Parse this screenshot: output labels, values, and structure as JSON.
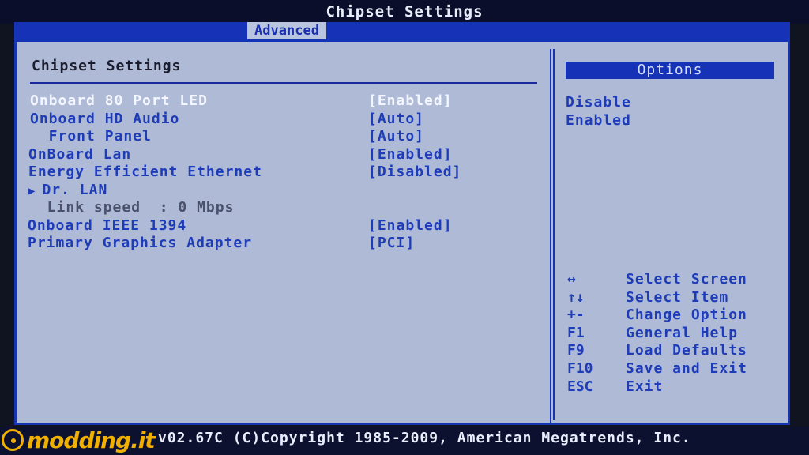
{
  "title": "Chipset Settings",
  "tab": "Advanced",
  "section_heading": "Chipset Settings",
  "settings": [
    {
      "label": "Onboard 80 Port LED",
      "value": "[Enabled]",
      "selected": true
    },
    {
      "label": "Onboard HD Audio",
      "value": "[Auto]"
    },
    {
      "label": "  Front Panel",
      "value": "[Auto]"
    },
    {
      "label": "OnBoard Lan",
      "value": "[Enabled]"
    },
    {
      "label": "Energy Efficient Ethernet",
      "value": "[Disabled]"
    },
    {
      "label": "Dr. LAN",
      "value": "",
      "submenu": true
    },
    {
      "label": "  Link speed  : 0 Mbps",
      "value": "",
      "info": true
    },
    {
      "label": "Onboard IEEE 1394",
      "value": "[Enabled]"
    },
    {
      "label": "Primary Graphics Adapter",
      "value": "[PCI]"
    }
  ],
  "options_header": "Options",
  "options": [
    "Disable",
    "Enabled"
  ],
  "help": [
    {
      "key": "↔",
      "desc": "Select Screen"
    },
    {
      "key": "↑↓",
      "desc": "Select Item"
    },
    {
      "key": "+-",
      "desc": "Change Option"
    },
    {
      "key": "F1",
      "desc": "General Help"
    },
    {
      "key": "F9",
      "desc": "Load Defaults"
    },
    {
      "key": "F10",
      "desc": "Save and Exit"
    },
    {
      "key": "ESC",
      "desc": "Exit"
    }
  ],
  "footer": "v02.67C (C)Copyright 1985-2009, American Megatrends, Inc.",
  "watermark": "modding.it"
}
